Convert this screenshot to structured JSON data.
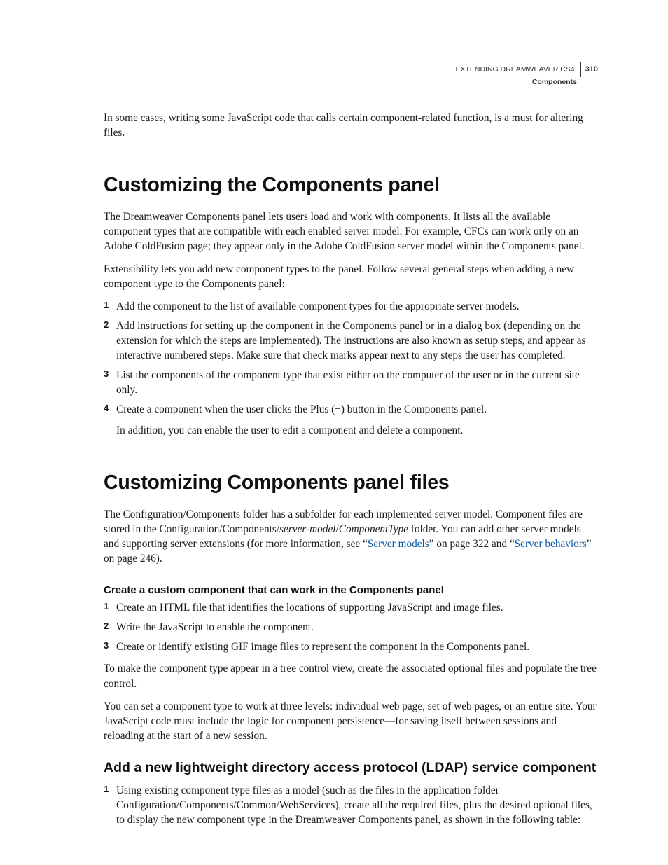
{
  "header": {
    "book_title": "EXTENDING DREAMWEAVER CS4",
    "section": "Components",
    "page_number": "310"
  },
  "intro_para": "In some cases, writing some JavaScript code that calls certain component-related function, is a must for altering files.",
  "s1": {
    "title": "Customizing the Components panel",
    "p1": "The Dreamweaver Components panel lets users load and work with components. It lists all the available component types that are compatible with each enabled server model. For example, CFCs can work only on an Adobe ColdFusion page; they appear only in the Adobe ColdFusion server model within the Components panel.",
    "p2": "Extensibility lets you add new component types to the panel. Follow several general steps when adding a new component type to the Components panel:",
    "li1": "Add the component to the list of available component types for the appropriate server models.",
    "li2": "Add instructions for setting up the component in the Components panel or in a dialog box (depending on the extension for which the steps are implemented). The instructions are also known as setup steps, and appear as interactive numbered steps. Make sure that check marks appear next to any steps the user has completed.",
    "li3": "List the components of the component type that exist either on the computer of the user or in the current site only.",
    "li4": "Create a component when the user clicks the Plus (+) button in the Components panel.",
    "li4_follow": "In addition, you can enable the user to edit a component and delete a component."
  },
  "s2": {
    "title": "Customizing Components panel files",
    "p1_a": "The Configuration/Components folder has a subfolder for each implemented server model. Component files are stored in the Configuration/Components/",
    "p1_b": "server-model",
    "p1_c": "/",
    "p1_d": "ComponentType",
    "p1_e": " folder. You can add other server models and supporting server extensions (for more information, see “",
    "link1": "Server models",
    "p1_f": "” on page 322 and “",
    "link2": "Server behaviors",
    "p1_g": "” on page 246).",
    "runin": "Create a custom component that can work in the Components panel",
    "li1": "Create an HTML file that identifies the locations of supporting JavaScript and image files.",
    "li2": "Write the JavaScript to enable the component.",
    "li3": "Create or identify existing GIF image files to represent the component in the Components panel.",
    "p2": "To make the component type appear in a tree control view, create the associated optional files and populate the tree control.",
    "p3": "You can set a component type to work at three levels: individual web page, set of web pages, or an entire site. Your JavaScript code must include the logic for component persistence—for saving itself between sessions and reloading at the start of a new session.",
    "sub_title": "Add a new lightweight directory access protocol (LDAP) service component",
    "sub_li1": "Using existing component type files as a model (such as the files in the application folder Configuration/Components/Common/WebServices), create all the required files, plus the desired optional files, to display the new component type in the Dreamweaver Components panel, as shown in the following table:"
  }
}
